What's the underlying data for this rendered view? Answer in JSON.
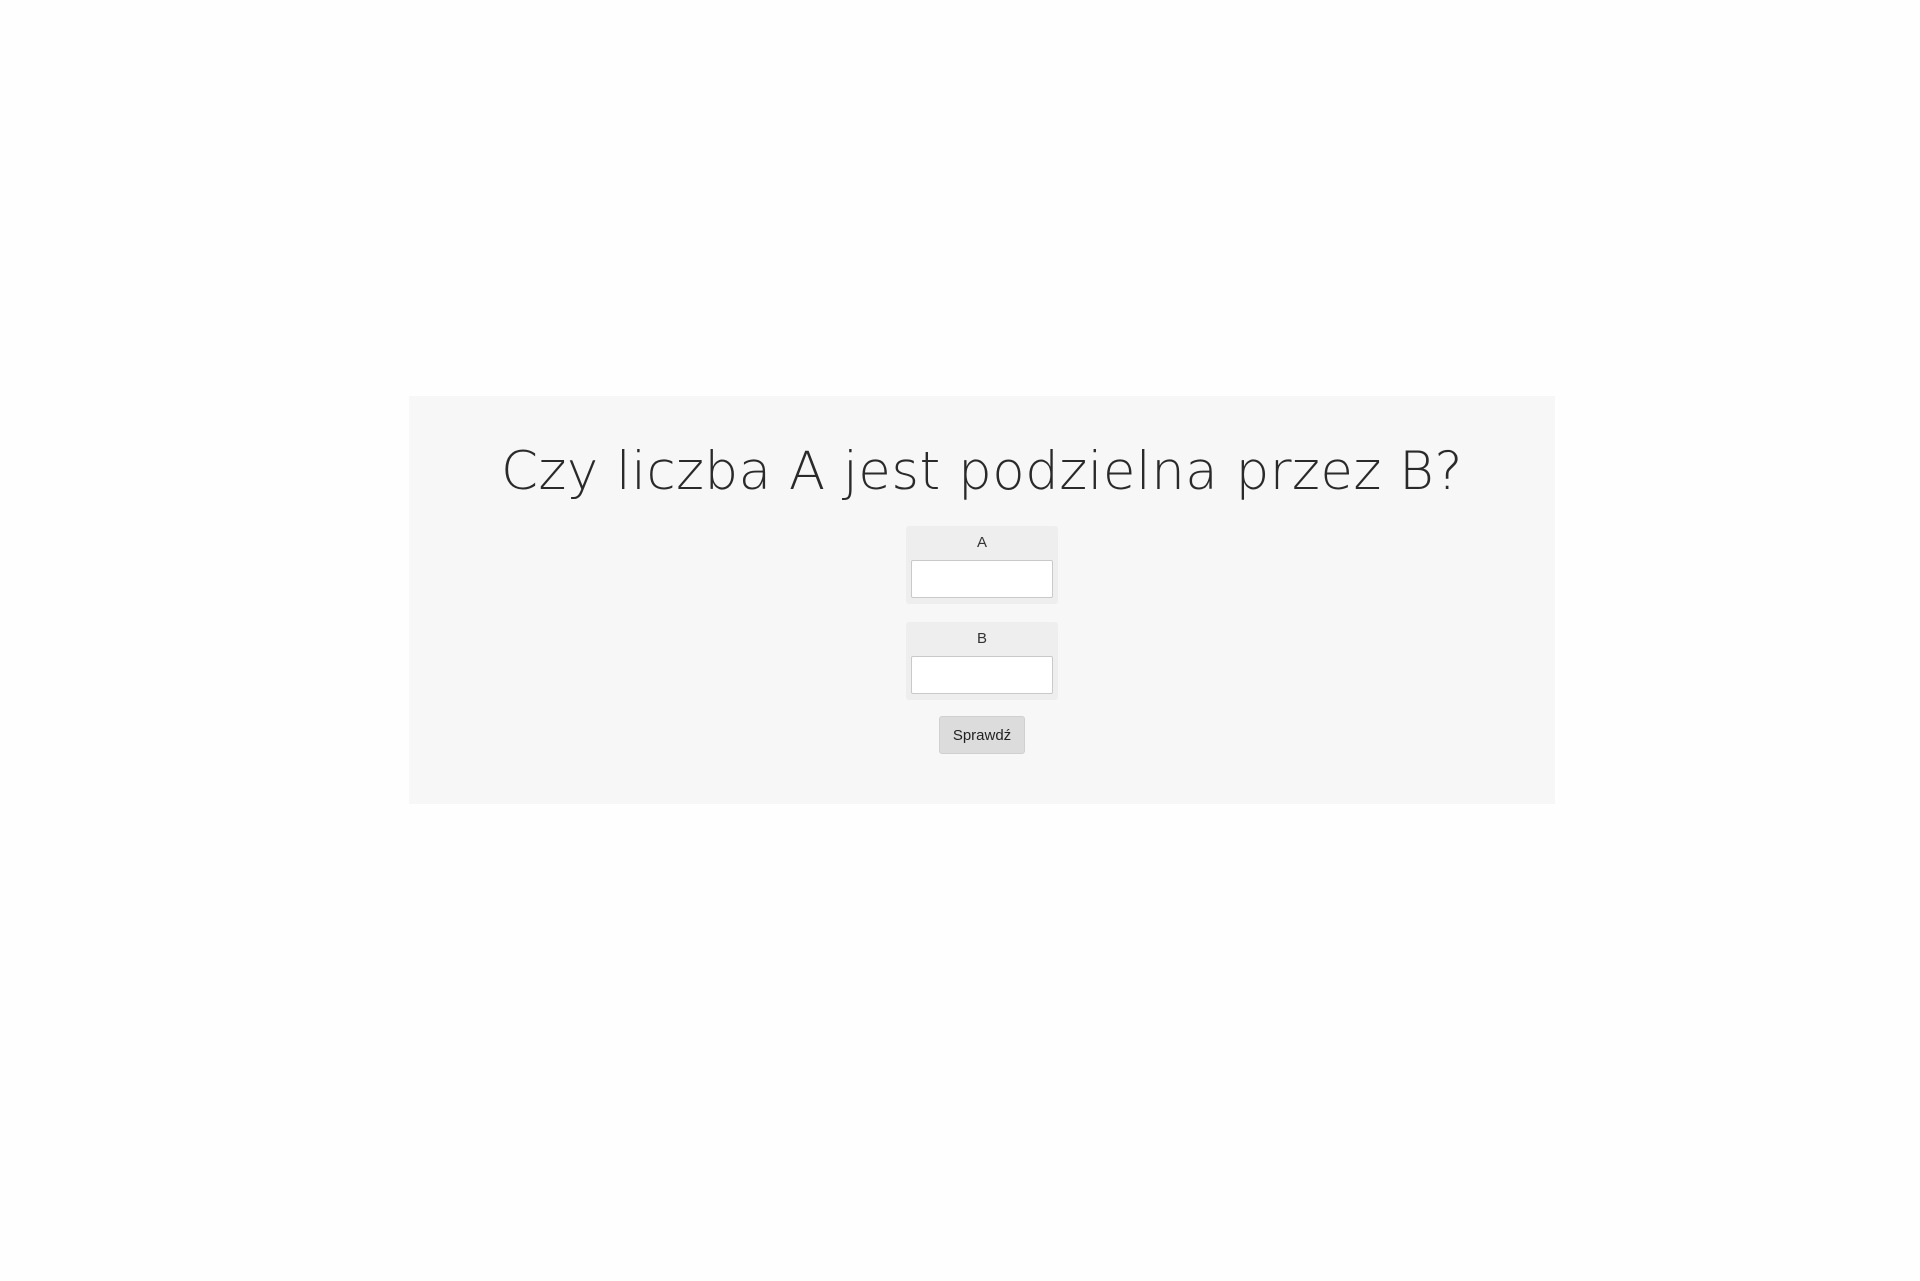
{
  "form": {
    "title": "Czy liczba A jest podzielna przez B?",
    "field_a": {
      "label": "A",
      "value": "",
      "placeholder": ""
    },
    "field_b": {
      "label": "B",
      "value": "",
      "placeholder": ""
    },
    "submit_label": "Sprawdź"
  }
}
